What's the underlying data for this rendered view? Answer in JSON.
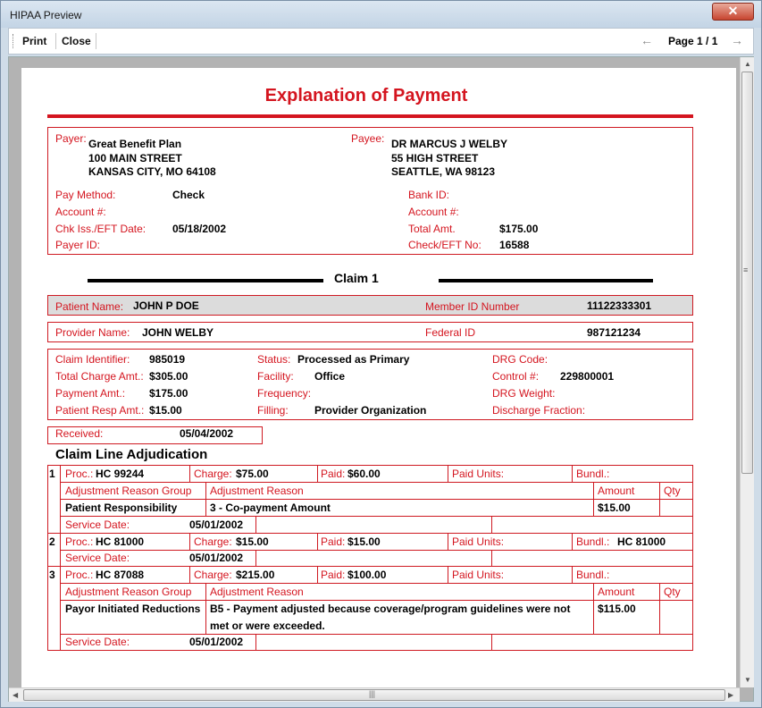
{
  "window": {
    "title": "HIPAA Preview",
    "close_glyph": "✕"
  },
  "toolbar": {
    "print": "Print",
    "close": "Close",
    "page_label": "Page 1 / 1",
    "prev_glyph": "←",
    "next_glyph": "→"
  },
  "doc": {
    "title": "Explanation of Payment",
    "payer": {
      "label": "Payer:",
      "name": "Great Benefit Plan",
      "address": "100 MAIN STREET",
      "city": "KANSAS CITY, MO 64108"
    },
    "payee": {
      "label": "Payee:",
      "name": "DR MARCUS J WELBY",
      "address": "55 HIGH STREET",
      "city": "SEATTLE, WA 98123"
    },
    "payment_info": {
      "pay_method_label": "Pay Method:",
      "pay_method": "Check",
      "account_label": "Account #:",
      "chk_date_label": "Chk Iss./EFT Date:",
      "chk_date": "05/18/2002",
      "payer_id_label": "Payer ID:",
      "bank_id_label": "Bank ID:",
      "account2_label": "Account #:",
      "total_amt_label": "Total Amt.",
      "total_amt": "$175.00",
      "check_no_label": "Check/EFT No:",
      "check_no": "16588"
    },
    "claim_heading": "Claim 1",
    "patient": {
      "name_label": "Patient Name:",
      "name": "JOHN P DOE",
      "member_label": "Member ID Number",
      "member_id": "11122333301"
    },
    "provider": {
      "name_label": "Provider Name:",
      "name": "JOHN WELBY",
      "federal_label": "Federal ID",
      "federal_id": "987121234"
    },
    "claim": {
      "identifier_label": "Claim Identifier:",
      "identifier": "985019",
      "total_charge_label": "Total Charge Amt.:",
      "total_charge": "$305.00",
      "payment_label": "Payment Amt.:",
      "payment": "$175.00",
      "patient_resp_label": "Patient Resp Amt.:",
      "patient_resp": "$15.00",
      "status_label": "Status:",
      "status": "Processed as Primary",
      "facility_label": "Facility:",
      "facility": "Office",
      "frequency_label": "Frequency:",
      "filling_label": "Filling:",
      "filling": "Provider Organization",
      "drg_code_label": "DRG Code:",
      "control_label": "Control #:",
      "control": "229800001",
      "drg_weight_label": "DRG Weight:",
      "discharge_label": "Discharge Fraction:"
    },
    "received": {
      "label": "Received:",
      "date": "05/04/2002"
    },
    "adjudication_heading": "Claim Line Adjudication",
    "col_labels": {
      "proc": "Proc.:",
      "charge": "Charge:",
      "paid": "Paid:",
      "paid_units": "Paid Units:",
      "bundl": "Bundl.:",
      "adj_group": "Adjustment Reason Group",
      "adj_reason": "Adjustment Reason",
      "amount": "Amount",
      "qty": "Qty",
      "service_date": "Service Date:"
    },
    "lines": [
      {
        "num": "1",
        "proc": "HC 99244",
        "charge": "$75.00",
        "paid": "$60.00",
        "bundl": "",
        "adj_group": "Patient Responsibility",
        "adj_reason": "3 - Co-payment Amount",
        "amount": "$15.00",
        "service_date": "05/01/2002"
      },
      {
        "num": "2",
        "proc": "HC 81000",
        "charge": "$15.00",
        "paid": "$15.00",
        "bundl": "HC 81000",
        "service_date": "05/01/2002"
      },
      {
        "num": "3",
        "proc": "HC 87088",
        "charge": "$215.00",
        "paid": "$100.00",
        "bundl": "",
        "adj_group": "Payor Initiated Reductions",
        "adj_reason_1": "B5 - Payment adjusted because coverage/program guidelines were not",
        "adj_reason_2": "met or were exceeded.",
        "amount": "$115.00",
        "service_date": "05/01/2002"
      }
    ]
  }
}
